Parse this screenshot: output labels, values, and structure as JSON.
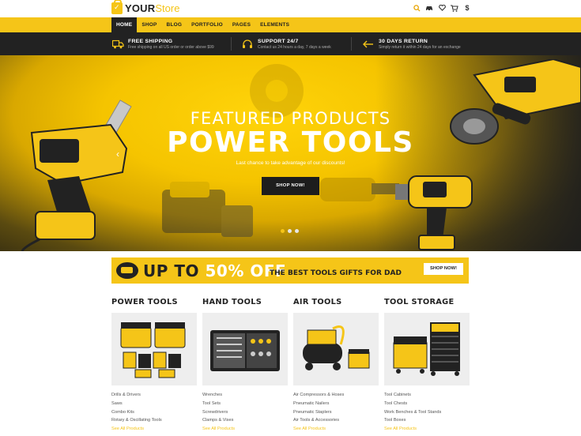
{
  "logo": {
    "brand": "YOUR",
    "suffix": "Store"
  },
  "header_icons": [
    "search-icon",
    "car-icon",
    "heart-icon",
    "cart-icon",
    "dollar-icon"
  ],
  "nav": [
    {
      "label": "HOME",
      "active": true
    },
    {
      "label": "SHOP"
    },
    {
      "label": "BLOG"
    },
    {
      "label": "PORTFOLIO"
    },
    {
      "label": "PAGES"
    },
    {
      "label": "ELEMENTS"
    }
  ],
  "features": [
    {
      "icon": "truck-icon",
      "title": "FREE SHIPPING",
      "subtitle": "Free shipping on all US order or order above $99"
    },
    {
      "icon": "headset-icon",
      "title": "SUPPORT 24/7",
      "subtitle": "Contact us 24 hours a day, 7 days a week"
    },
    {
      "icon": "return-icon",
      "title": "30 DAYS RETURN",
      "subtitle": "Simply return it within 24 days for an exchange"
    }
  ],
  "hero": {
    "overline": "FEATURED PRODUCTS",
    "title": "POWER TOOLS",
    "tagline": "Last chance to take advantage of our discounts!",
    "button": "SHOP NOW!",
    "slide_count": 3,
    "active_slide": 1
  },
  "promo": {
    "up_to": "UP TO",
    "percent": "50% OFF",
    "text": "THE BEST TOOLS GIFTS FOR DAD",
    "button": "SHOP NOW!"
  },
  "categories": [
    {
      "title": "POWER TOOLS",
      "links": [
        "Drills & Drivers",
        "Saws",
        "Combo Kits",
        "Rotary & Oscillating Tools",
        "See All Products"
      ]
    },
    {
      "title": "HAND TOOLS",
      "links": [
        "Wrenches",
        "Tool Sets",
        "Screwdrivers",
        "Clamps & Vises",
        "See All Products"
      ]
    },
    {
      "title": "AIR TOOLS",
      "links": [
        "Air Compressors & Hoses",
        "Pneumatic Nailers",
        "Pneumatic Staplers",
        "Air Tools & Accessories",
        "See All Products"
      ]
    },
    {
      "title": "TOOL STORAGE",
      "links": [
        "Tool Cabinets",
        "Tool Chests",
        "Work Benches & Tool Stands",
        "Tool Boxes",
        "See All Products"
      ]
    }
  ],
  "colors": {
    "accent": "#f5c518",
    "dark": "#222222"
  }
}
